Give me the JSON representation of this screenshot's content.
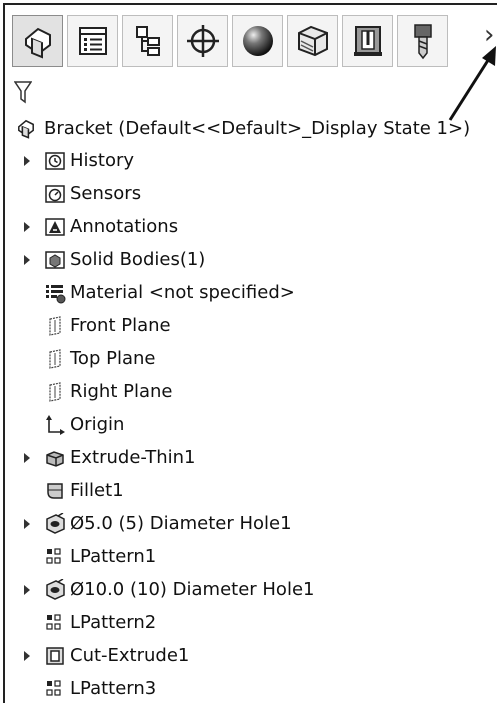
{
  "toolbar": {
    "tabs": [
      {
        "icon": "featuremanager-tree-icon"
      },
      {
        "icon": "propertymanager-icon"
      },
      {
        "icon": "configurationmanager-icon"
      },
      {
        "icon": "dimxpertmanager-icon"
      },
      {
        "icon": "displaymanager-sphere-icon"
      },
      {
        "icon": "cam-feature-tree-icon"
      },
      {
        "icon": "cam-operation-tree-icon"
      },
      {
        "icon": "cam-tool-tree-icon"
      }
    ],
    "more": "›"
  },
  "tree": {
    "root_label": "Bracket  (Default<<Default>_Display State 1>)",
    "items": [
      {
        "label": "History",
        "expandable": true,
        "icon": "history-icon"
      },
      {
        "label": "Sensors",
        "expandable": false,
        "icon": "sensors-icon"
      },
      {
        "label": "Annotations",
        "expandable": true,
        "icon": "annotations-icon"
      },
      {
        "label": "Solid Bodies(1)",
        "expandable": true,
        "icon": "solid-bodies-icon"
      },
      {
        "label": "Material <not specified>",
        "expandable": false,
        "icon": "material-icon"
      },
      {
        "label": "Front Plane",
        "expandable": false,
        "icon": "plane-icon"
      },
      {
        "label": "Top Plane",
        "expandable": false,
        "icon": "plane-icon"
      },
      {
        "label": "Right Plane",
        "expandable": false,
        "icon": "plane-icon"
      },
      {
        "label": "Origin",
        "expandable": false,
        "icon": "origin-icon"
      },
      {
        "label": "Extrude-Thin1",
        "expandable": true,
        "icon": "extrude-icon"
      },
      {
        "label": "Fillet1",
        "expandable": false,
        "icon": "fillet-icon"
      },
      {
        "label": "Ø5.0 (5) Diameter Hole1",
        "expandable": true,
        "icon": "hole-wizard-icon"
      },
      {
        "label": "LPattern1",
        "expandable": false,
        "icon": "linear-pattern-icon"
      },
      {
        "label": "Ø10.0 (10) Diameter Hole1",
        "expandable": true,
        "icon": "hole-wizard-icon"
      },
      {
        "label": "LPattern2",
        "expandable": false,
        "icon": "linear-pattern-icon"
      },
      {
        "label": "Cut-Extrude1",
        "expandable": true,
        "icon": "cut-extrude-icon"
      },
      {
        "label": "LPattern3",
        "expandable": false,
        "icon": "linear-pattern-icon"
      }
    ]
  }
}
